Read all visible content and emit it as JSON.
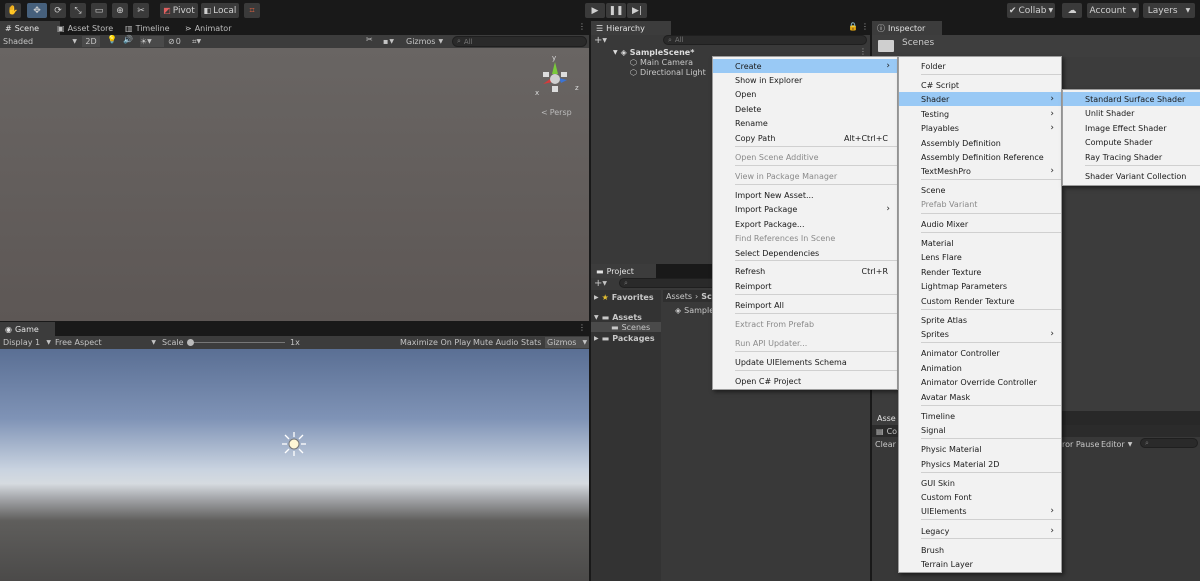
{
  "toolbar": {
    "tools": [
      "hand-tool-icon",
      "move-tool-icon",
      "rotate-tool-icon",
      "scale-tool-icon",
      "rect-tool-icon",
      "transform-tool-icon",
      "custom-tool-icon"
    ],
    "pivot": "Pivot",
    "local": "Local",
    "collab": "Collab",
    "account": "Account",
    "layers": "Layers"
  },
  "scene": {
    "tabs": [
      "Scene",
      "Asset Store",
      "Timeline",
      "Animator"
    ],
    "shading": "Shaded",
    "mode2d": "2D",
    "hidden_count": "0",
    "gizmos": "Gizmos",
    "search_placeholder": "All",
    "persp": "Persp",
    "axis_x": "x",
    "axis_y": "y",
    "axis_z": "z"
  },
  "game": {
    "tab": "Game",
    "display": "Display 1",
    "aspect": "Free Aspect",
    "scale_label": "Scale",
    "scale_value": "1x",
    "maximize": "Maximize On Play",
    "mute": "Mute Audio",
    "stats": "Stats",
    "gizmos": "Gizmos"
  },
  "hierarchy": {
    "tab": "Hierarchy",
    "search_placeholder": "All",
    "scene": "SampleScene*",
    "items": [
      "Main Camera",
      "Directional Light"
    ]
  },
  "inspector": {
    "tab": "Inspector",
    "folder": "Scenes"
  },
  "project": {
    "tab": "Project",
    "favorites": "Favorites",
    "assets": "Assets",
    "scenes": "Scenes",
    "packages": "Packages",
    "breadcrumb_assets": "Assets",
    "breadcrumb_partial": "Sc",
    "asset_item": "Sample"
  },
  "console": {
    "tab_partial": "Asse",
    "tab2_partial": "Co",
    "clear": "Clear",
    "error_pause": "ror Pause",
    "editor": "Editor"
  },
  "context_menu": {
    "items": [
      {
        "label": "Create",
        "arrow": true,
        "highlight": true
      },
      {
        "label": "Show in Explorer"
      },
      {
        "label": "Open"
      },
      {
        "label": "Delete"
      },
      {
        "label": "Rename"
      },
      {
        "label": "Copy Path",
        "shortcut": "Alt+Ctrl+C"
      },
      {
        "label": "Open Scene Additive",
        "disabled": true
      },
      {
        "label": "View in Package Manager",
        "disabled": true
      },
      {
        "label": "Import New Asset..."
      },
      {
        "label": "Import Package",
        "arrow": true
      },
      {
        "label": "Export Package..."
      },
      {
        "label": "Find References In Scene",
        "disabled": true
      },
      {
        "label": "Select Dependencies"
      },
      {
        "label": "Refresh",
        "shortcut": "Ctrl+R"
      },
      {
        "label": "Reimport"
      },
      {
        "label": "Reimport All"
      },
      {
        "label": "Extract From Prefab",
        "disabled": true
      },
      {
        "label": "Run API Updater...",
        "disabled": true
      },
      {
        "label": "Update UIElements Schema"
      },
      {
        "label": "Open C# Project"
      }
    ]
  },
  "create_menu": {
    "items": [
      {
        "label": "Folder"
      },
      {
        "label": "C# Script"
      },
      {
        "label": "Shader",
        "arrow": true,
        "highlight": true
      },
      {
        "label": "Testing",
        "arrow": true
      },
      {
        "label": "Playables",
        "arrow": true
      },
      {
        "label": "Assembly Definition"
      },
      {
        "label": "Assembly Definition Reference"
      },
      {
        "label": "TextMeshPro",
        "arrow": true
      },
      {
        "label": "Scene"
      },
      {
        "label": "Prefab Variant",
        "disabled": true
      },
      {
        "label": "Audio Mixer"
      },
      {
        "label": "Material"
      },
      {
        "label": "Lens Flare"
      },
      {
        "label": "Render Texture"
      },
      {
        "label": "Lightmap Parameters"
      },
      {
        "label": "Custom Render Texture"
      },
      {
        "label": "Sprite Atlas"
      },
      {
        "label": "Sprites",
        "arrow": true
      },
      {
        "label": "Animator Controller"
      },
      {
        "label": "Animation"
      },
      {
        "label": "Animator Override Controller"
      },
      {
        "label": "Avatar Mask"
      },
      {
        "label": "Timeline"
      },
      {
        "label": "Signal"
      },
      {
        "label": "Physic Material"
      },
      {
        "label": "Physics Material 2D"
      },
      {
        "label": "GUI Skin"
      },
      {
        "label": "Custom Font"
      },
      {
        "label": "UIElements",
        "arrow": true
      },
      {
        "label": "Legacy",
        "arrow": true
      },
      {
        "label": "Brush"
      },
      {
        "label": "Terrain Layer"
      }
    ]
  },
  "shader_menu": {
    "items": [
      {
        "label": "Standard Surface Shader",
        "highlight": true
      },
      {
        "label": "Unlit Shader"
      },
      {
        "label": "Image Effect Shader"
      },
      {
        "label": "Compute Shader"
      },
      {
        "label": "Ray Tracing Shader"
      },
      {
        "label": "Shader Variant Collection"
      }
    ]
  }
}
